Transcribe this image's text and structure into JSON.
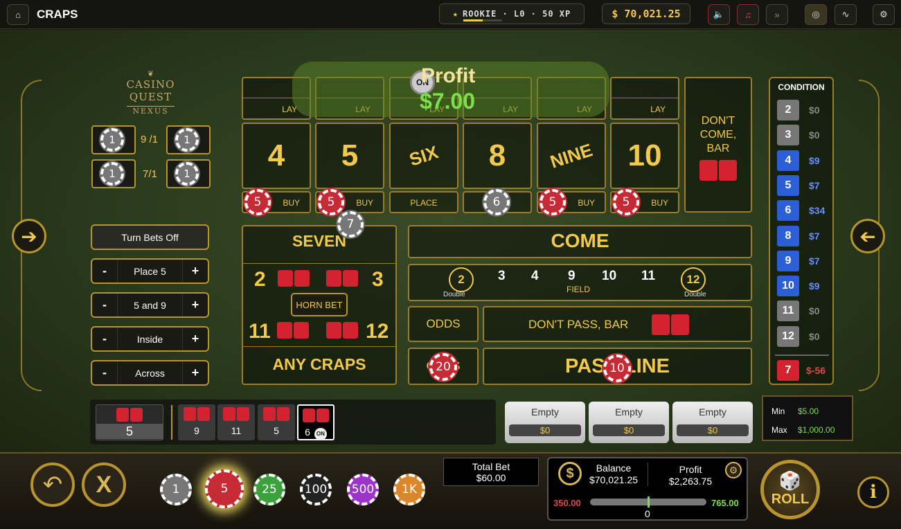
{
  "header": {
    "title": "CRAPS",
    "rank": "ROOKIE · L0 · 50 XP",
    "balance": "$ 70,021.25"
  },
  "logo": {
    "line1": "CASINO QUEST",
    "line2": "NEXUS"
  },
  "props": [
    {
      "chip": "1",
      "odds": "9 /1",
      "chip2": "1"
    },
    {
      "chip": "1",
      "odds": "7/1",
      "chip2": "1"
    }
  ],
  "side_controls": {
    "turn_off": "Turn Bets Off",
    "items": [
      "Place 5",
      "5 and 9",
      "Inside",
      "Across"
    ],
    "minus": "-",
    "plus": "+"
  },
  "profit_popup": {
    "label": "Profit",
    "amount": "$7.00",
    "puck": "ON"
  },
  "numbers": [
    {
      "label": "4",
      "lay": "LAY",
      "bottom": "BUY",
      "chip": "5"
    },
    {
      "label": "5",
      "lay": "LAY",
      "bottom": "BUY",
      "chip": "5"
    },
    {
      "label": "SIX",
      "lay": "LAY",
      "bottom": "PLACE",
      "chip": ""
    },
    {
      "label": "8",
      "lay": "LAY",
      "bottom": "",
      "chip": "6"
    },
    {
      "label": "NINE",
      "lay": "LAY",
      "bottom": "BUY",
      "chip": "5"
    },
    {
      "label": "10",
      "lay": "LAY",
      "bottom": "BUY",
      "chip": "5"
    }
  ],
  "dont_come": {
    "line1": "DON'T",
    "line2": "COME,",
    "line3": "BAR"
  },
  "props_box": {
    "seven": "SEVEN",
    "seven_chip": "7",
    "two": "2",
    "three": "3",
    "eleven": "11",
    "twelve": "12",
    "horn": "HORN BET",
    "any_craps": "ANY CRAPS"
  },
  "come": "COME",
  "field": {
    "numbers": [
      "3",
      "4",
      "9",
      "10",
      "11"
    ],
    "left": "2",
    "right": "12",
    "double": "Double",
    "label": "FIELD"
  },
  "odds": "ODDS",
  "odds_chip": "20",
  "dont_pass": "DON'T PASS, BAR",
  "pass_line": "PASS LINE",
  "pass_chip": "10",
  "condition": {
    "title": "CONDITION",
    "rows": [
      {
        "n": "2",
        "v": "$0"
      },
      {
        "n": "3",
        "v": "$0"
      },
      {
        "n": "4",
        "v": "$9"
      },
      {
        "n": "5",
        "v": "$7"
      },
      {
        "n": "6",
        "v": "$34"
      },
      {
        "n": "8",
        "v": "$7"
      },
      {
        "n": "9",
        "v": "$7"
      },
      {
        "n": "10",
        "v": "$9"
      },
      {
        "n": "11",
        "v": "$0"
      },
      {
        "n": "12",
        "v": "$0"
      }
    ],
    "seven": {
      "n": "7",
      "v": "$-56"
    }
  },
  "history": {
    "current": "5",
    "rolls": [
      "9",
      "11",
      "5",
      "6"
    ],
    "on": "ON"
  },
  "bet_slots": [
    {
      "label": "Empty",
      "value": "$0"
    },
    {
      "label": "Empty",
      "value": "$0"
    },
    {
      "label": "Empty",
      "value": "$0"
    }
  ],
  "limits": {
    "min_label": "Min",
    "min": "$5.00",
    "max_label": "Max",
    "max": "$1,000.00"
  },
  "chips": [
    "1",
    "5",
    "25",
    "100",
    "500",
    "1K"
  ],
  "total_bet": {
    "label": "Total Bet",
    "value": "$60.00"
  },
  "wallet": {
    "balance_label": "Balance",
    "balance": "$70,021.25",
    "profit_label": "Profit",
    "profit": "$2,263.75",
    "low": "350.00",
    "high": "765.00",
    "mid": "0"
  },
  "roll": "ROLL",
  "colors": {
    "gold": "#f2c94c",
    "red": "#d32330",
    "blue": "#2c5fd6",
    "green": "#7be04a"
  }
}
